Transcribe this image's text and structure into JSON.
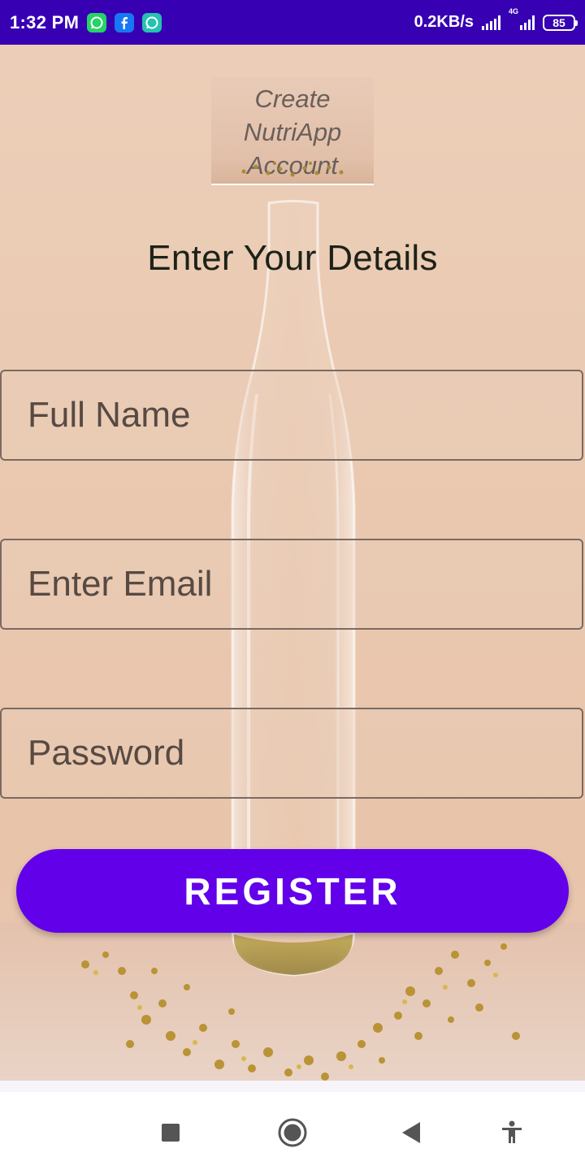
{
  "status_bar": {
    "time": "1:32 PM",
    "net_speed": "0.2KB/s",
    "network_type": "4G",
    "battery": "85",
    "notification_icons": [
      "whatsapp-icon",
      "facebook-icon",
      "whatsapp-business-icon"
    ]
  },
  "header": {
    "title": "Create NutriApp Account"
  },
  "form": {
    "heading": "Enter Your Details",
    "full_name_placeholder": "Full Name",
    "email_placeholder": "Enter Email",
    "password_placeholder": "Password",
    "register_label": "REGISTER"
  },
  "nav_bar": {
    "icons": [
      "recent-apps-icon",
      "home-icon",
      "back-icon",
      "accessibility-icon"
    ]
  },
  "colors": {
    "status_bar": "#3700b3",
    "button": "#6200ea",
    "background": "#ecceb8"
  }
}
